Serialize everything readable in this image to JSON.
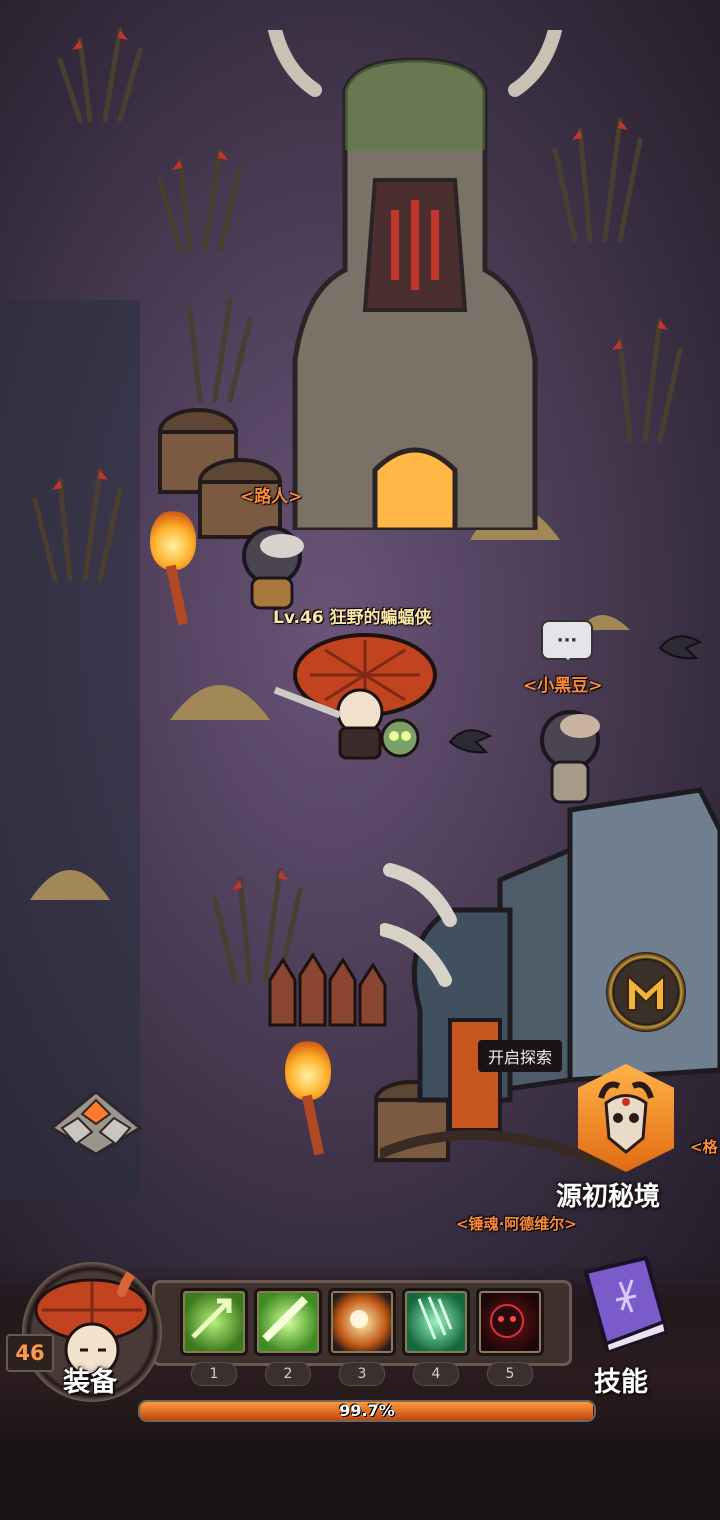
{
  "world": {
    "npcs": [
      {
        "name": "<路人>"
      },
      {
        "name": "<小黑豆>"
      },
      {
        "name": "<锤魂·阿德维尔>"
      }
    ],
    "player": {
      "tag": "Lv.46 狂野的蝙蝠侠"
    },
    "chat_bubble": "···",
    "explore_label": "开启探索",
    "realm_label": "源初秘境",
    "side_label": "<格"
  },
  "hud": {
    "level": "46",
    "equip_label": "装备",
    "skill_label": "技能",
    "xp_percent_text": "99.7%",
    "xp_fraction": 0.997,
    "skills": [
      {
        "slot": "1",
        "icon": "green-arrow-icon",
        "color": "#6fc43a"
      },
      {
        "slot": "2",
        "icon": "green-slash-icon",
        "color": "#7be04a"
      },
      {
        "slot": "3",
        "icon": "fire-orb-icon",
        "color": "#ff9a3a"
      },
      {
        "slot": "4",
        "icon": "green-rain-icon",
        "color": "#3fd17a"
      },
      {
        "slot": "5",
        "icon": "demon-face-icon",
        "color": "#d0303a"
      }
    ]
  }
}
